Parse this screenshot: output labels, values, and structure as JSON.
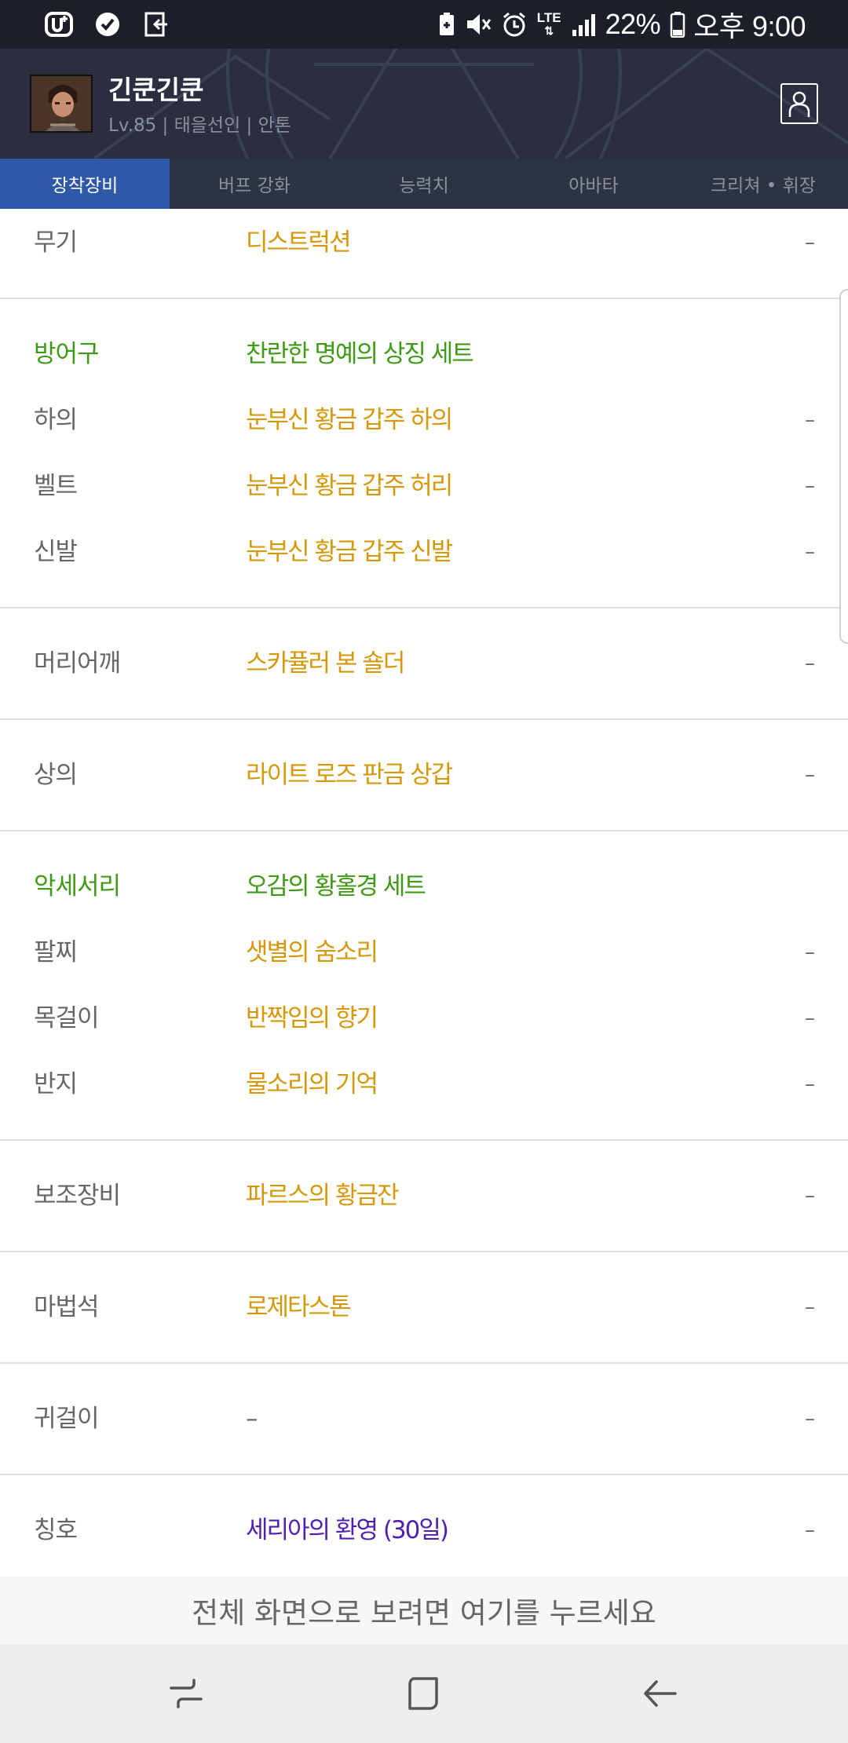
{
  "status_bar": {
    "left_icons": [
      "u-plus-icon",
      "settings-badge-icon",
      "exit-icon"
    ],
    "right_icons": [
      "battery-saver-icon",
      "mute-icon",
      "alarm-icon"
    ],
    "network": "LTE",
    "battery_percent": "22%",
    "time": "오후 9:00"
  },
  "header": {
    "character_name": "긴쿤긴쿤",
    "character_info": "Lv.85 | 태을선인 | 안톤"
  },
  "tabs": [
    {
      "label": "장착장비",
      "active": true
    },
    {
      "label": "버프 강화",
      "active": false
    },
    {
      "label": "능력치",
      "active": false
    },
    {
      "label": "아바타",
      "active": false
    },
    {
      "label": "크리쳐 • 휘장",
      "active": false
    }
  ],
  "equipment": {
    "weapon": {
      "slot": "무기",
      "item": "디스트럭션",
      "value": "–"
    },
    "armor_set": {
      "slot": "방어구",
      "item": "찬란한 명예의 상징 세트"
    },
    "pants": {
      "slot": "하의",
      "item": "눈부신 황금 갑주 하의",
      "value": "–"
    },
    "belt": {
      "slot": "벨트",
      "item": "눈부신 황금 갑주 허리",
      "value": "–"
    },
    "shoes": {
      "slot": "신발",
      "item": "눈부신 황금 갑주 신발",
      "value": "–"
    },
    "shoulder": {
      "slot": "머리어깨",
      "item": "스카퓰러 본 숄더",
      "value": "–"
    },
    "top": {
      "slot": "상의",
      "item": "라이트 로즈 판금 상갑",
      "value": "–"
    },
    "accessory_set": {
      "slot": "악세서리",
      "item": "오감의 황홀경 세트"
    },
    "bracelet": {
      "slot": "팔찌",
      "item": "샛별의 숨소리",
      "value": "–"
    },
    "necklace": {
      "slot": "목걸이",
      "item": "반짝임의 향기",
      "value": "–"
    },
    "ring": {
      "slot": "반지",
      "item": "물소리의 기억",
      "value": "–"
    },
    "sub": {
      "slot": "보조장비",
      "item": "파르스의 황금잔",
      "value": "–"
    },
    "magic_stone": {
      "slot": "마법석",
      "item": "로제타스톤",
      "value": "–"
    },
    "earring": {
      "slot": "귀걸이",
      "item": "–",
      "value": "–"
    },
    "title": {
      "slot": "칭호",
      "item": "세리아의 환영 (30일)",
      "value": "–"
    }
  },
  "colors": {
    "rare_item": "#d4980a",
    "set_label": "#3f9a15",
    "title_item": "#5020b0",
    "active_tab": "#2f58a8",
    "header_bg": "#2a2e3e"
  },
  "fullscreen_banner": "전체 화면으로 보려면 여기를 누르세요",
  "nav_bar": {
    "icons": [
      "recent-apps-icon",
      "home-icon",
      "back-icon"
    ]
  }
}
